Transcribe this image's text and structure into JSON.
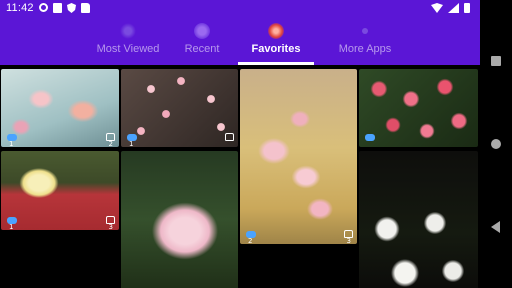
{
  "status_bar": {
    "time": "11:42",
    "icons": [
      "gear-icon",
      "a-box-icon",
      "shield-icon",
      "sim-card-icon",
      "wifi-icon",
      "signal-icon",
      "battery-icon"
    ]
  },
  "tabs": [
    {
      "label": "Most Viewed",
      "active": false,
      "icon": "trending-icon"
    },
    {
      "label": "Recent",
      "active": false,
      "icon": "clock-icon"
    },
    {
      "label": "Favorites",
      "active": true,
      "icon": "heart-icon"
    },
    {
      "label": "More Apps",
      "active": false,
      "icon": "apps-icon"
    }
  ],
  "tiles": [
    {
      "subject": "orchid",
      "comments": "1",
      "likes": "2",
      "has_stats": true
    },
    {
      "subject": "pink-blossoms",
      "comments": "1",
      "likes": "",
      "has_stats": true
    },
    {
      "subject": "peach-blossom",
      "comments": "2",
      "likes": "3",
      "has_stats": true
    },
    {
      "subject": "pink-roses",
      "comments": "",
      "likes": "",
      "has_stats": true
    },
    {
      "subject": "yellow-rose",
      "comments": "1",
      "likes": "3",
      "has_stats": true
    },
    {
      "subject": "pink-wild-rose",
      "comments": "",
      "likes": "",
      "has_stats": false
    },
    {
      "subject": "white-roses",
      "comments": "",
      "likes": "",
      "has_stats": false
    }
  ],
  "colors": {
    "primary": "#5b16d6",
    "comment_icon": "#4aa3ff"
  },
  "nav_bar": {
    "icons": [
      "square-recents-icon",
      "circle-home-icon",
      "triangle-back-icon"
    ]
  }
}
